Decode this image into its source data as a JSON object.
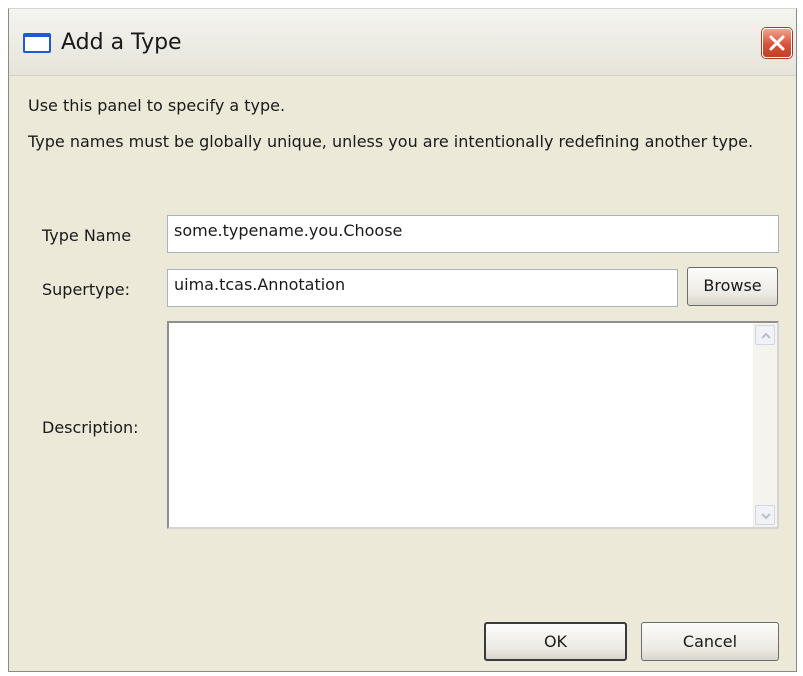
{
  "window": {
    "title": "Add a Type"
  },
  "panel": {
    "intro": "Use this panel to specify a type.",
    "notice": "Type names must be globally unique, unless you are intentionally redefining another type."
  },
  "form": {
    "type_name": {
      "label": "Type Name",
      "value": "some.typename.you.Choose"
    },
    "supertype": {
      "label": "Supertype:",
      "value": "uima.tcas.Annotation",
      "browse_label": "Browse"
    },
    "description": {
      "label": "Description:",
      "value": ""
    }
  },
  "buttons": {
    "ok": "OK",
    "cancel": "Cancel"
  },
  "icons": {
    "window": "window-icon",
    "close": "close-icon",
    "scroll_up": "scroll-up-arrow-icon",
    "scroll_down": "scroll-down-arrow-icon"
  },
  "colors": {
    "close_button": "#d9533a",
    "window_icon": "#1e5bd3",
    "dialog_background": "#ece9d8"
  }
}
